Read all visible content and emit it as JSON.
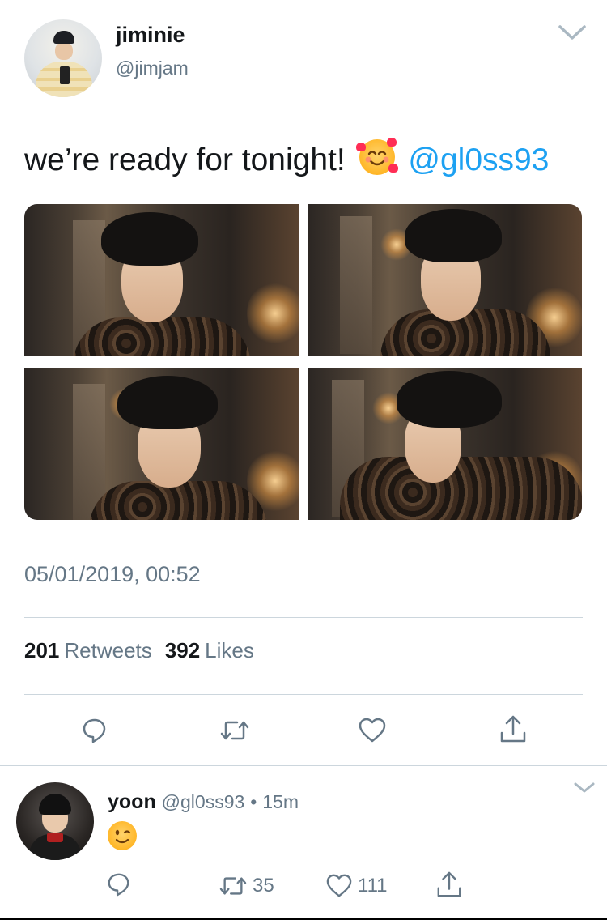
{
  "tweet": {
    "display_name": "jiminie",
    "handle": "@jimjam",
    "text": "we’re ready for tonight!",
    "mention": "@gl0ss93",
    "timestamp": "05/01/2019, 00:52",
    "stats": {
      "retweets_count": "201",
      "retweets_label": "Retweets",
      "likes_count": "392",
      "likes_label": "Likes"
    },
    "photos": [
      "photo-1",
      "photo-2",
      "photo-3",
      "photo-4"
    ],
    "actions": [
      "reply-icon",
      "retweet-icon",
      "like-icon",
      "share-icon"
    ]
  },
  "reply": {
    "display_name": "yoon",
    "handle": "@gl0ss93",
    "separator": "•",
    "time": "15m",
    "text_emoji": "winking-face-emoji",
    "retweets": "35",
    "likes": "111"
  },
  "colors": {
    "text": "#14171a",
    "secondary": "#657786",
    "link": "#1da1f2",
    "divider": "#ccd6dd"
  }
}
